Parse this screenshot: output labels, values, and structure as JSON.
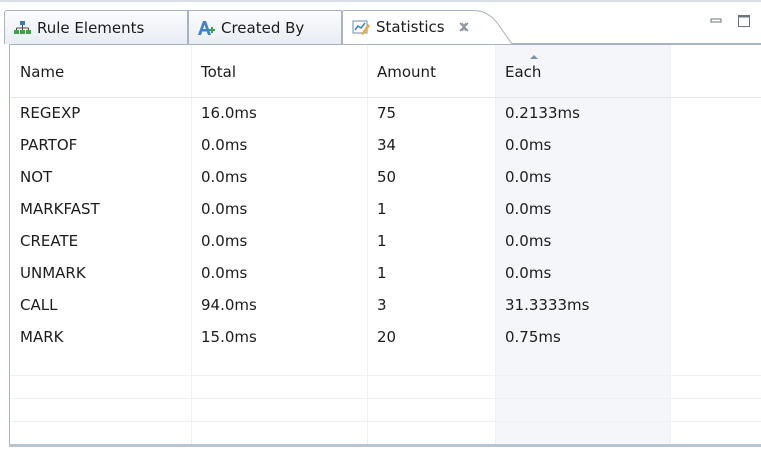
{
  "tabs": {
    "rule_elements": {
      "label": "Rule Elements",
      "icon": "hierarchy-icon"
    },
    "created_by": {
      "label": "Created By",
      "icon": "letter-a-plus-icon"
    },
    "statistics": {
      "label": "Statistics",
      "icon": "chart-pencil-icon",
      "close": "close-icon"
    }
  },
  "window_controls": {
    "minimize": "minimize-icon",
    "maximize": "maximize-icon"
  },
  "table": {
    "columns": [
      "Name",
      "Total",
      "Amount",
      "Each",
      ""
    ],
    "sorted_column": "Each",
    "rows": [
      [
        "REGEXP",
        "16.0ms",
        "75",
        "0.2133ms"
      ],
      [
        "PARTOF",
        "0.0ms",
        "34",
        "0.0ms"
      ],
      [
        "NOT",
        "0.0ms",
        "50",
        "0.0ms"
      ],
      [
        "MARKFAST",
        "0.0ms",
        "1",
        "0.0ms"
      ],
      [
        "CREATE",
        "0.0ms",
        "1",
        "0.0ms"
      ],
      [
        "UNMARK",
        "0.0ms",
        "1",
        "0.0ms"
      ],
      [
        "CALL",
        "94.0ms",
        "3",
        "31.3333ms"
      ],
      [
        "MARK",
        "15.0ms",
        "20",
        "0.75ms"
      ]
    ]
  },
  "colors": {
    "tab_border": "#a7b2c4",
    "sorted_column_bg": "#f4f6f9",
    "grid_line": "#eef1f4"
  }
}
